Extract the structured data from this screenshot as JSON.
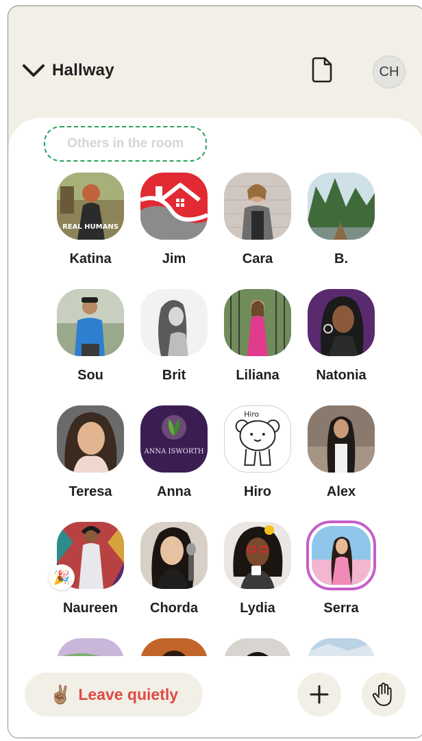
{
  "header": {
    "room_name": "Hallway",
    "user_initials": "CH"
  },
  "section": {
    "label": "Others in the room"
  },
  "people": [
    {
      "name": "Katina",
      "avatar_text": "REAL HUMANS"
    },
    {
      "name": "Jim"
    },
    {
      "name": "Cara"
    },
    {
      "name": "B."
    },
    {
      "name": "Sou"
    },
    {
      "name": "Brit"
    },
    {
      "name": "Liliana"
    },
    {
      "name": "Natonia"
    },
    {
      "name": "Teresa"
    },
    {
      "name": "Anna",
      "avatar_text": "ANNA ISWORTH"
    },
    {
      "name": "Hiro",
      "avatar_text": "Hiro"
    },
    {
      "name": "Alex"
    },
    {
      "name": "Naureen"
    },
    {
      "name": "Chorda"
    },
    {
      "name": "Lydia"
    },
    {
      "name": "Serra"
    }
  ],
  "footer": {
    "leave_label": "Leave quietly",
    "leave_emoji": "✌🏽"
  },
  "icons": {
    "back": "chevron-down-icon",
    "document": "document-icon",
    "add": "plus-icon",
    "raise_hand": "raise-hand-icon"
  },
  "colors": {
    "header_bg": "#f1efe6",
    "accent_red": "#e04a44",
    "dashed_green": "#27a05a",
    "speaker_ring": "#c65ec8"
  }
}
